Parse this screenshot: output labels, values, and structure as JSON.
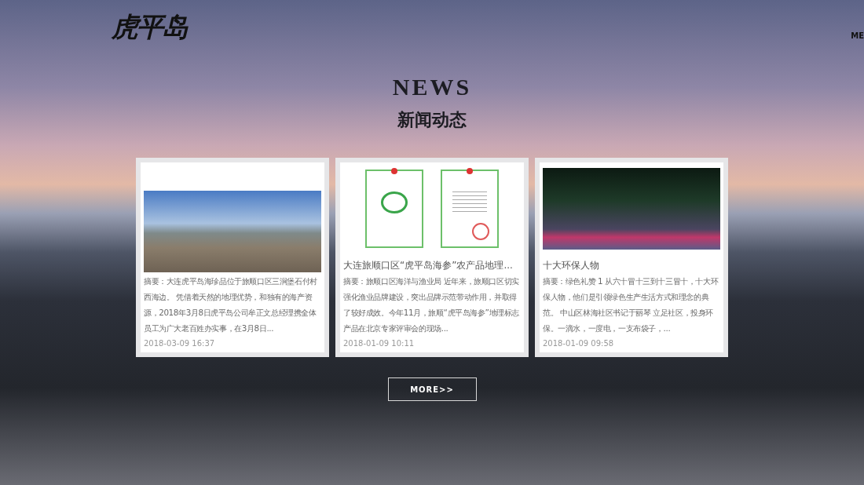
{
  "logo": "虎平岛",
  "menu_label": "ME",
  "heading": {
    "title": "NEWS",
    "subtitle": "新闻动态"
  },
  "news": [
    {
      "kind": "landscape",
      "summary": "摘要：大连虎平岛海珍品位于旅顺口区三涧堡石付村西海边。 凭借着天然的地理优势，和独有的海产资源，2018年3月8日虎平岛公司牟正文总经理携全体员工为广大老百姓办实事，在3月8日...",
      "date": "2018-03-09 16:37"
    },
    {
      "kind": "certificate",
      "title": "大连旅顺口区“虎平岛海参”农产品地理...",
      "summary": "摘要：旅顺口区海洋与渔业局 近年来，旅顺口区切实强化渔业品牌建设，突出品牌示范带动作用，并取得了较好成效。今年11月，旅顺“虎平岛海参”地理标志产品在北京专家评审会的现场...",
      "date": "2018-01-09 10:11"
    },
    {
      "kind": "stage",
      "title": "十大环保人物",
      "summary": "摘要：绿色礼赞 1 从六十冒十三到十三冒十，十大环保人物，他们是引领绿色生产生活方式和理念的典范。 中山区林海社区书记于丽琴 立足社区，投身环保。一滴水，一度电，一支布袋子，...",
      "date": "2018-01-09 09:58"
    }
  ],
  "more_button": "MORE>>"
}
